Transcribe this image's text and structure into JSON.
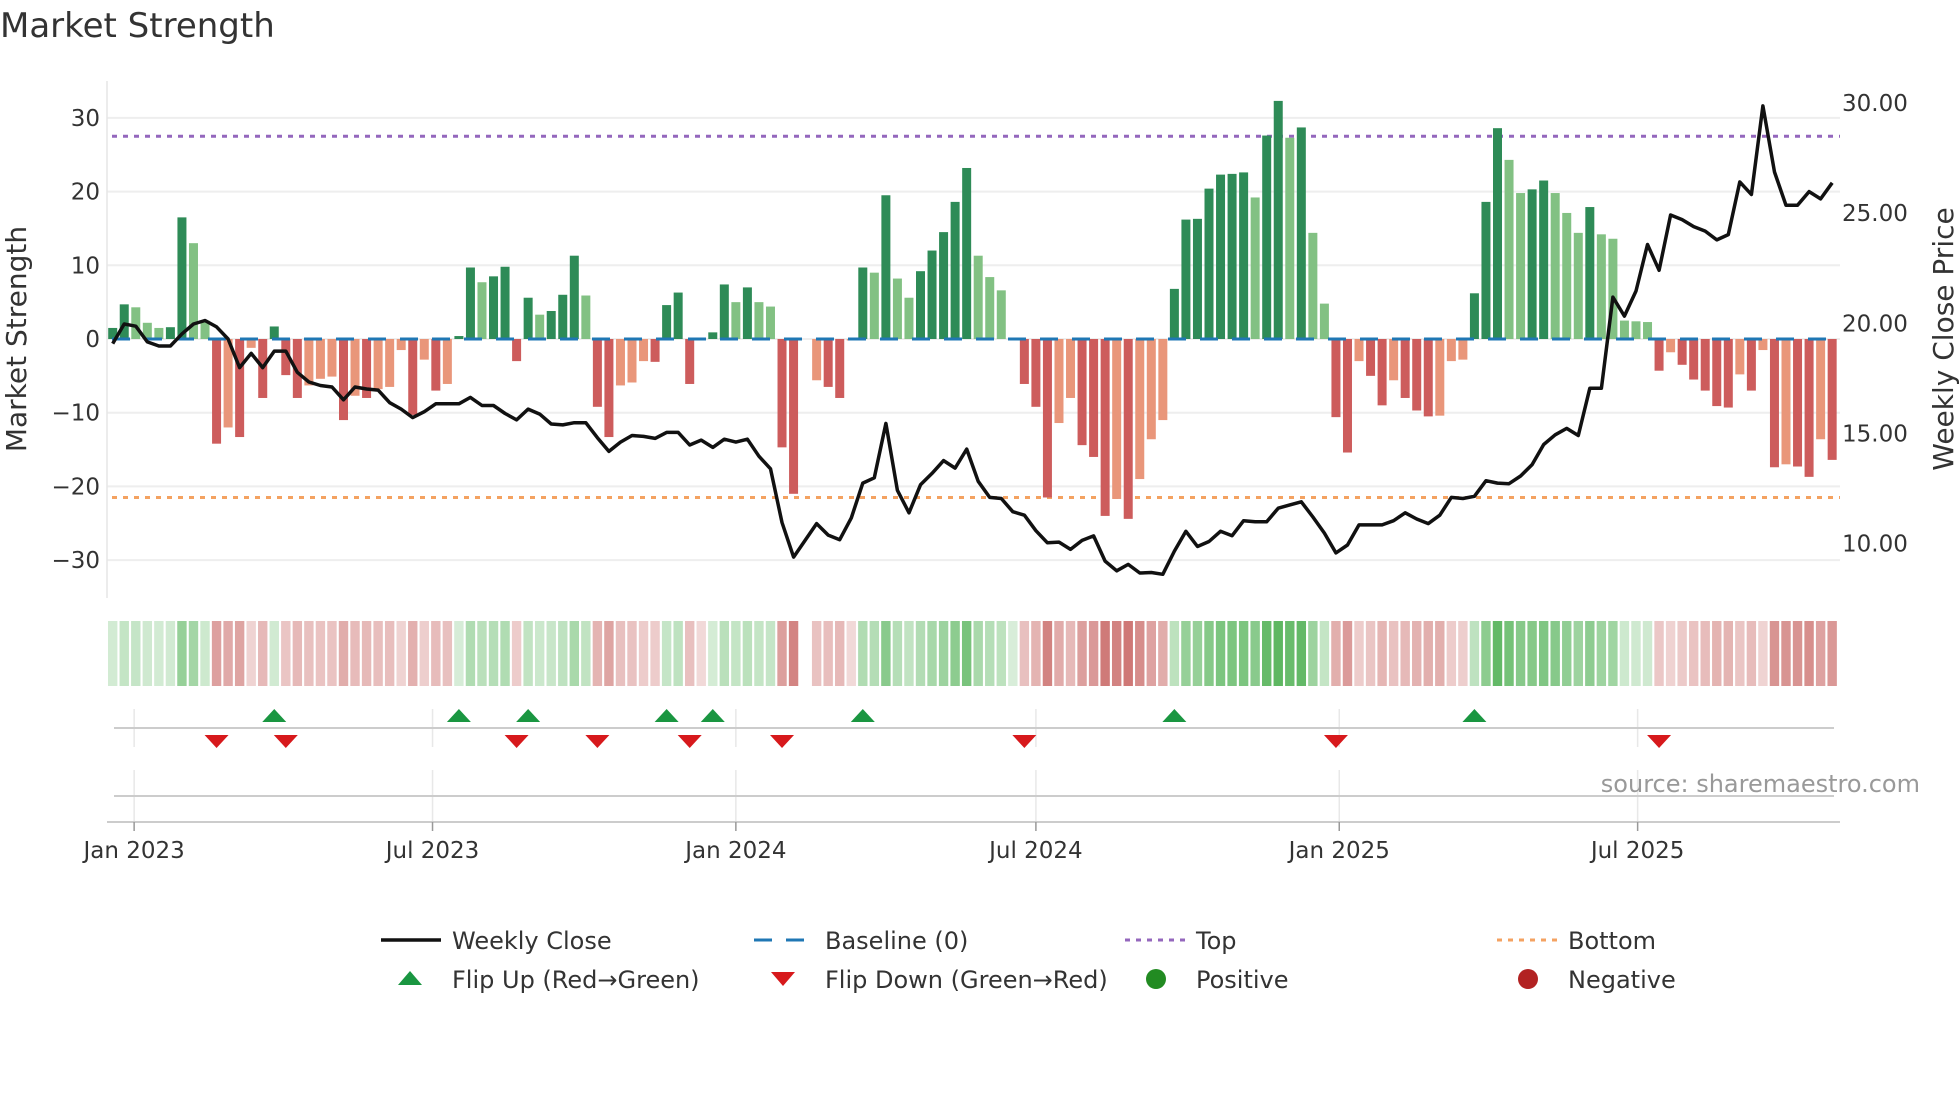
{
  "chart_data": {
    "type": "bar",
    "title": "Market Strength",
    "ylabel": "Market Strength",
    "y2label": "Weekly Close Price",
    "ylim": [
      -35,
      35
    ],
    "yticks": [
      30,
      20,
      10,
      0,
      -10,
      -20,
      -30
    ],
    "yticklabels": [
      "30",
      "20",
      "10",
      "0",
      "−10",
      "−20",
      "−30"
    ],
    "y2ticks": [
      30,
      25,
      20,
      15,
      10
    ],
    "y2ticklabels": [
      "30.00",
      "25.00",
      "20.00",
      "15.00",
      "10.00"
    ],
    "x_start": "2022-12-19",
    "x_frequency": "weekly",
    "xticks": [
      {
        "label": "Jan 2023",
        "date": "2023-01-01"
      },
      {
        "label": "Jul 2023",
        "date": "2023-07-01"
      },
      {
        "label": "Jan 2024",
        "date": "2024-01-01"
      },
      {
        "label": "Jul 2024",
        "date": "2024-07-01"
      },
      {
        "label": "Jan 2025",
        "date": "2025-01-01"
      },
      {
        "label": "Jul 2025",
        "date": "2025-07-01"
      }
    ],
    "levels": {
      "top": 27.5,
      "bottom": -21.5,
      "baseline": 0
    },
    "series": [
      {
        "name": "Market Strength",
        "kind": "bar",
        "values": [
          1.5,
          4.7,
          4.3,
          2.2,
          1.5,
          1.6,
          16.5,
          13,
          2.5,
          -14.2,
          -12,
          -13.3,
          -1.2,
          -8,
          1.7,
          -4.9,
          -8,
          -6.3,
          -5.4,
          -5.1,
          -11,
          -7.7,
          -8,
          -6.8,
          -6.5,
          -1.5,
          -10.3,
          -2.8,
          -7,
          -6.1,
          0.4,
          9.7,
          7.7,
          8.5,
          9.8,
          -3,
          5.6,
          3.3,
          3.8,
          6,
          11.3,
          5.9,
          -9.2,
          -13.3,
          -6.3,
          -5.9,
          -3,
          -3.1,
          4.6,
          6.3,
          -6.1,
          -0.2,
          0.9,
          7.4,
          5,
          7,
          5,
          4.4,
          -14.7,
          -21,
          null,
          -5.6,
          -6.5,
          -8,
          -0.2,
          9.7,
          9,
          19.5,
          8.2,
          5.6,
          9.2,
          12,
          14.5,
          18.6,
          23.2,
          11.3,
          8.4,
          6.6,
          0.2,
          -6.1,
          -9.2,
          -21.5,
          -11.4,
          -8,
          -14.4,
          -16,
          -24,
          -21.7,
          -24.4,
          -19,
          -13.6,
          -11,
          6.8,
          16.2,
          16.3,
          20.4,
          22.3,
          22.4,
          22.6,
          19.2,
          27.6,
          32.3,
          27.3,
          28.7,
          14.4,
          4.8,
          -10.6,
          -15.4,
          -3,
          -5,
          -9,
          -5.6,
          -8,
          -9.7,
          -10.5,
          -10.4,
          -3,
          -2.8,
          6.2,
          18.6,
          28.6,
          24.3,
          19.8,
          20.3,
          21.5,
          19.8,
          17.1,
          14.4,
          17.9,
          14.2,
          13.6,
          2.5,
          2.4,
          2.3,
          -4.3,
          -1.8,
          -3.5,
          -5.5,
          -7,
          -9.1,
          -9.3,
          -4.8,
          -7,
          -1.5,
          -17.4,
          -17,
          -17.3,
          -18.7,
          -13.6,
          -16.4
        ]
      },
      {
        "name": "Weekly Close",
        "kind": "line",
        "axis": "right",
        "values": [
          19.08,
          19.97,
          19.87,
          19.16,
          18.97,
          18.97,
          19.52,
          19.97,
          20.13,
          19.84,
          19.29,
          17.99,
          18.64,
          17.99,
          18.74,
          18.74,
          17.78,
          17.34,
          17.18,
          17.11,
          16.53,
          17.11,
          17.02,
          16.97,
          16.4,
          16.11,
          15.72,
          15.99,
          16.35,
          16.35,
          16.35,
          16.64,
          16.27,
          16.27,
          15.91,
          15.62,
          16.11,
          15.88,
          15.43,
          15.39,
          15.49,
          15.49,
          14.81,
          14.19,
          14.61,
          14.91,
          14.87,
          14.78,
          15.05,
          15.05,
          14.48,
          14.7,
          14.37,
          14.74,
          14.61,
          14.74,
          13.97,
          13.4,
          10.96,
          9.39,
          10.15,
          10.91,
          10.39,
          10.18,
          11.17,
          12.75,
          12.99,
          15.46,
          12.42,
          11.4,
          12.67,
          13.19,
          13.77,
          13.43,
          14.29,
          12.83,
          12.1,
          12.05,
          11.45,
          11.29,
          10.59,
          10.04,
          10.07,
          9.74,
          10.15,
          10.35,
          9.21,
          8.77,
          9.06,
          8.67,
          8.69,
          8.61,
          9.66,
          10.56,
          9.87,
          10.1,
          10.56,
          10.36,
          11.04,
          10.99,
          10.99,
          11.61,
          11.76,
          11.9,
          11.21,
          10.48,
          9.58,
          9.94,
          10.85,
          10.85,
          10.85,
          11.04,
          11.4,
          11.12,
          10.91,
          11.29,
          12.1,
          12.05,
          12.15,
          12.86,
          12.75,
          12.72,
          13.07,
          13.59,
          14.5,
          14.94,
          15.23,
          14.91,
          17.05,
          17.05,
          21.19,
          20.33,
          21.47,
          23.58,
          22.41,
          24.92,
          24.71,
          24.39,
          24.19,
          23.79,
          24.03,
          26.42,
          25.85,
          29.87,
          26.87,
          25.36,
          25.36,
          25.98,
          25.65,
          26.38
        ]
      }
    ],
    "flip_up_weeks": [
      14,
      30,
      36,
      48,
      52,
      65,
      92,
      118
    ],
    "flip_down_weeks": [
      9,
      15,
      35,
      42,
      50,
      58,
      79,
      106,
      134
    ],
    "legend_position": "bottom",
    "legend": [
      {
        "label": "Weekly Close",
        "kind": "line"
      },
      {
        "label": "Baseline (0)",
        "kind": "baseline"
      },
      {
        "label": "Top",
        "kind": "top"
      },
      {
        "label": "Bottom",
        "kind": "bottom"
      },
      {
        "label": "Flip Up (Red→Green)",
        "kind": "up"
      },
      {
        "label": "Flip Down (Green→Red)",
        "kind": "down"
      },
      {
        "label": "Positive",
        "kind": "pos"
      },
      {
        "label": "Negative",
        "kind": "neg"
      }
    ],
    "source": "source: sharemaestro.com"
  },
  "colors": {
    "pos_strong": "#2e8b57",
    "pos_weak": "#82c183",
    "neg_strong": "#cd5c5c",
    "neg_weak": "#e9967a",
    "line": "#111111",
    "baseline": "#1f77b4",
    "top": "#9467bd",
    "bottom": "#f4a261",
    "flip_up": "#1a9641",
    "flip_down": "#d7191c",
    "positive": "#228b22",
    "negative": "#b22222",
    "heat_pos": "#4caf50",
    "heat_neg": "#c0504d"
  }
}
